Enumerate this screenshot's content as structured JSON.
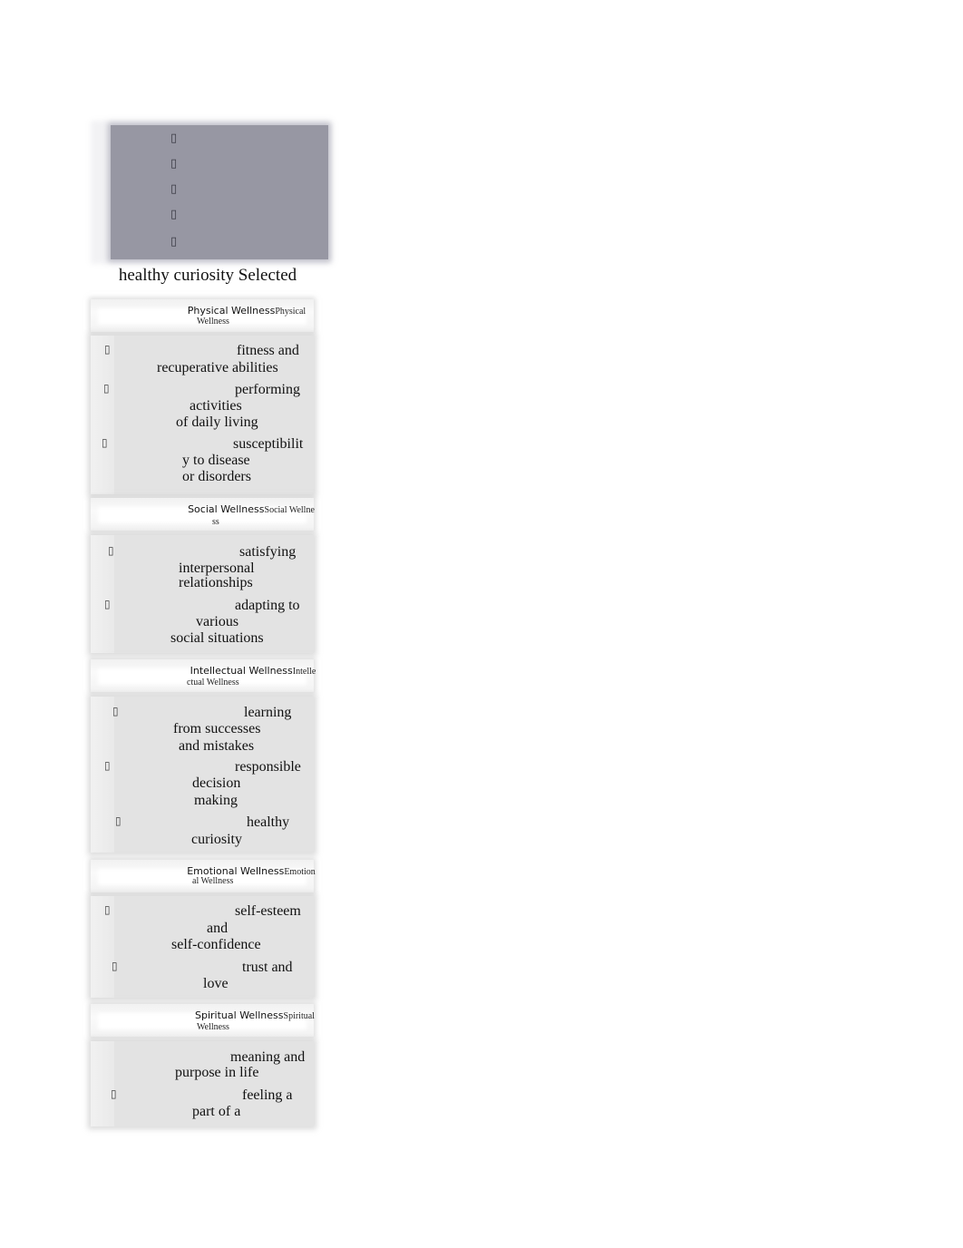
{
  "top_panel": {
    "icons": [
      "checkbox-glyph",
      "checkbox-glyph",
      "checkbox-glyph",
      "checkbox-glyph",
      "checkbox-glyph"
    ],
    "glyph": "▯",
    "background": "#9797a3"
  },
  "selected_caption": "healthy curiosity Selected",
  "sections": [
    {
      "title_sans": "Physical Wellness",
      "title_serif_1": "Physical",
      "title_serif_2": "Wellness",
      "items": [
        {
          "lines": [
            "fitness and",
            "recuperative abilities"
          ],
          "bullet": "▯"
        },
        {
          "lines": [
            "performing",
            "activities",
            "of daily living"
          ],
          "bullet": "▯"
        },
        {
          "lines": [
            "susceptibilit",
            "y to disease",
            "or disorders"
          ],
          "bullet": "▯"
        }
      ]
    },
    {
      "title_sans": "Social Wellness",
      "title_serif_1": "Social Wellne",
      "title_serif_2": "ss",
      "items": [
        {
          "lines": [
            "satisfying",
            "interpersonal",
            "relationships"
          ],
          "bullet": "▯"
        },
        {
          "lines": [
            "adapting to",
            "various",
            "social situations"
          ],
          "bullet": "▯"
        }
      ]
    },
    {
      "title_sans": "Intellectual Wellness",
      "title_serif_1": "Intelle",
      "title_serif_2": "ctual Wellness",
      "items": [
        {
          "lines": [
            "learning",
            "from successes",
            "and mistakes"
          ],
          "bullet": "▯"
        },
        {
          "lines": [
            "responsible",
            "decision",
            "making"
          ],
          "bullet": "▯"
        },
        {
          "lines": [
            "healthy",
            "curiosity"
          ],
          "bullet": "▯"
        }
      ]
    },
    {
      "title_sans": "Emotional Wellness",
      "title_serif_1": "Emotion",
      "title_serif_2": "al Wellness",
      "items": [
        {
          "lines": [
            "self-esteem",
            "and",
            "self-confidence"
          ],
          "bullet": "▯"
        },
        {
          "lines": [
            "trust and",
            "love"
          ],
          "bullet": "▯"
        }
      ]
    },
    {
      "title_sans": "Spiritual Wellness",
      "title_serif_1": "Spiritual",
      "title_serif_2": "Wellness",
      "items": [
        {
          "lines": [
            "meaning and",
            "purpose in life"
          ],
          "bullet": ""
        },
        {
          "lines": [
            "feeling a",
            "part of a"
          ],
          "bullet": "▯"
        }
      ]
    }
  ]
}
